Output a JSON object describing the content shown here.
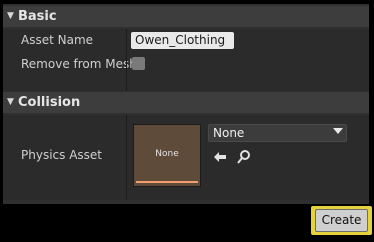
{
  "sections": {
    "basic": {
      "title": "Basic",
      "asset_name_label": "Asset Name",
      "asset_name_value": "Owen_Clothing",
      "remove_from_mesh_label": "Remove from Mesh",
      "remove_from_mesh_checked": false
    },
    "collision": {
      "title": "Collision",
      "physics_asset_label": "Physics Asset",
      "thumbnail_label": "None",
      "selected_value": "None"
    }
  },
  "footer": {
    "create_label": "Create"
  },
  "colors": {
    "highlight": "#e6d23a",
    "thumbnail_bg": "#5e4b3a",
    "thumbnail_bar": "#f0a070"
  },
  "icons": {
    "collapse": "triangle-down-icon",
    "use_selected": "arrow-left-icon",
    "browse": "search-icon",
    "dropdown": "chevron-down-icon"
  }
}
